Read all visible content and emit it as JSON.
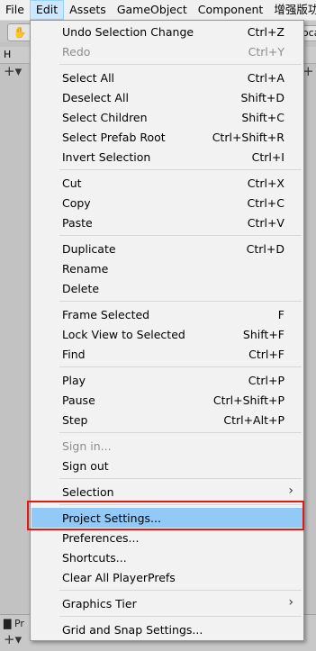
{
  "menubar": {
    "items": [
      "File",
      "Edit",
      "Assets",
      "GameObject",
      "Component",
      "增强版功能"
    ]
  },
  "background": {
    "hierarchy_tab": "H",
    "project_tab": "Pr",
    "local_button": "Loca"
  },
  "edit_menu": {
    "items": [
      {
        "label": "Undo Selection Change",
        "shortcut": "Ctrl+Z"
      },
      {
        "label": "Redo",
        "shortcut": "Ctrl+Y"
      },
      {
        "label": "Select All",
        "shortcut": "Ctrl+A"
      },
      {
        "label": "Deselect All",
        "shortcut": "Shift+D"
      },
      {
        "label": "Select Children",
        "shortcut": "Shift+C"
      },
      {
        "label": "Select Prefab Root",
        "shortcut": "Ctrl+Shift+R"
      },
      {
        "label": "Invert Selection",
        "shortcut": "Ctrl+I"
      },
      {
        "label": "Cut",
        "shortcut": "Ctrl+X"
      },
      {
        "label": "Copy",
        "shortcut": "Ctrl+C"
      },
      {
        "label": "Paste",
        "shortcut": "Ctrl+V"
      },
      {
        "label": "Duplicate",
        "shortcut": "Ctrl+D"
      },
      {
        "label": "Rename",
        "shortcut": ""
      },
      {
        "label": "Delete",
        "shortcut": ""
      },
      {
        "label": "Frame Selected",
        "shortcut": "F"
      },
      {
        "label": "Lock View to Selected",
        "shortcut": "Shift+F"
      },
      {
        "label": "Find",
        "shortcut": "Ctrl+F"
      },
      {
        "label": "Play",
        "shortcut": "Ctrl+P"
      },
      {
        "label": "Pause",
        "shortcut": "Ctrl+Shift+P"
      },
      {
        "label": "Step",
        "shortcut": "Ctrl+Alt+P"
      },
      {
        "label": "Sign in...",
        "shortcut": ""
      },
      {
        "label": "Sign out",
        "shortcut": ""
      },
      {
        "label": "Selection",
        "shortcut": ""
      },
      {
        "label": "Project Settings...",
        "shortcut": ""
      },
      {
        "label": "Preferences...",
        "shortcut": ""
      },
      {
        "label": "Shortcuts...",
        "shortcut": ""
      },
      {
        "label": "Clear All PlayerPrefs",
        "shortcut": ""
      },
      {
        "label": "Graphics Tier",
        "shortcut": ""
      },
      {
        "label": "Grid and Snap Settings...",
        "shortcut": ""
      }
    ]
  }
}
